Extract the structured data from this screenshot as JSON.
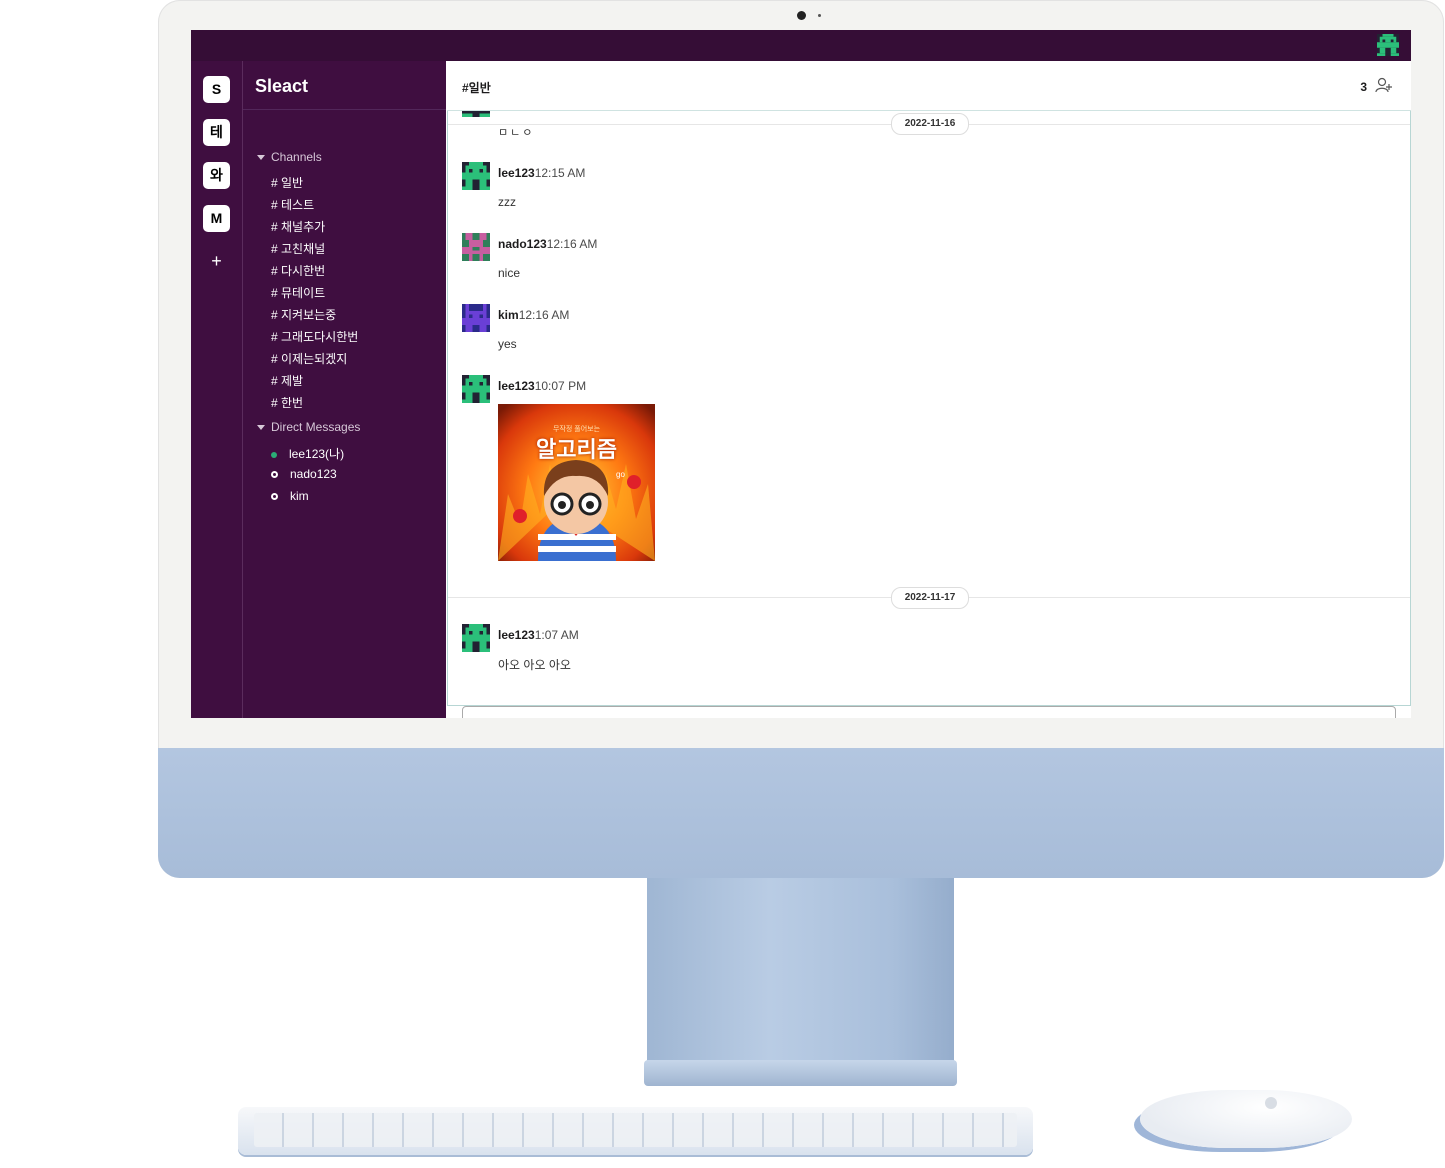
{
  "app": {
    "brand": "Sleact"
  },
  "workspaces": [
    "S",
    "테",
    "와",
    "M"
  ],
  "workspace_add": "+",
  "channel": {
    "name": "#일반",
    "member_count": "3"
  },
  "sidebar": {
    "channels_label": "Channels",
    "channels": [
      "# 일반",
      "# 테스트",
      "# 채널추가",
      "# 고친채널",
      "# 다시한번",
      "# 뮤테이트",
      "# 지켜보는중",
      "# 그래도다시한번",
      "# 이제는되겠지",
      "# 제발",
      "# 한번"
    ],
    "dm_label": "Direct Messages",
    "dms": [
      {
        "name": "lee123(나)",
        "online": true
      },
      {
        "name": "nado123",
        "online": false
      },
      {
        "name": "kim",
        "online": false
      }
    ]
  },
  "messages": {
    "partial_text": "ㅁㄴㅇ",
    "date1": "2022-11-16",
    "m1": {
      "user": "lee123",
      "time": "12:15 AM",
      "text": "zzz"
    },
    "m2": {
      "user": "nado123",
      "time": "12:16 AM",
      "text": "nice"
    },
    "m3": {
      "user": "kim",
      "time": "12:16 AM",
      "text": "yes"
    },
    "m4": {
      "user": "lee123",
      "time": "10:07 PM",
      "image_caption": "알고리즘",
      "image_small": "무작정 풀어보는",
      "image_tag": "go"
    },
    "date2": "2022-11-17",
    "m5": {
      "user": "lee123",
      "time": "1:07 AM",
      "text": "아오 아오 아오"
    }
  },
  "colors": {
    "sidebar_bg": "#3f0e40",
    "topbar_bg": "#350d36",
    "avatar_lee": "#2bbf7a",
    "avatar_nado": "#c75ea0",
    "avatar_kim": "#6a3fd6",
    "online": "#2bac76"
  }
}
